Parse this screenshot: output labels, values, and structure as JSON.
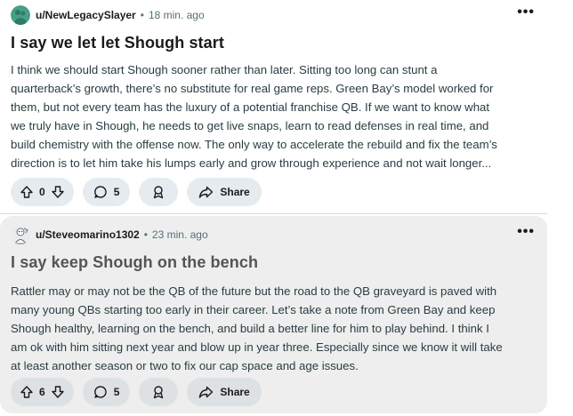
{
  "posts": [
    {
      "username": "u/NewLegacySlayer",
      "separator": "•",
      "time": "18 min. ago",
      "title": "I say we let let Shough start",
      "body_lines": [
        "I think we should start Shough sooner rather than later. Sitting too long can stunt a",
        "quarterback’s growth, there’s no substitute for real game reps. Green Bay’s model worked for",
        "them, but not every team has the luxury of a potential franchise QB. If we want to know what",
        "we truly have in Shough, he needs to get live snaps, learn to read defenses in real time, and",
        "build chemistry with the offense now. The only way to accelerate the rebuild and fix the team’s",
        "direction is to let him take his lumps early and grow through experience and not wait longer..."
      ],
      "votes": "0",
      "comments": "5",
      "share_label": "Share",
      "overflow": "•••"
    },
    {
      "username": "u/Steveomarino1302",
      "separator": "•",
      "time": "23 min. ago",
      "title": "I say keep Shough on the bench",
      "body_lines": [
        "Rattler may or may not be the QB of the future but the road to the QB graveyard is paved with",
        "many young QBs starting too early in their career. Let’s take a note from Green Bay and keep",
        "Shough healthy, learning on the bench, and build a better line for him to play behind. I think I",
        "am ok with him sitting next year and blow up in year three. Especially since we know it will take",
        "at least another season or two to fix our cap space and age issues."
      ],
      "votes": "6",
      "comments": "5",
      "share_label": "Share",
      "overflow": "•••"
    }
  ],
  "icons": {
    "upvote": "upvote-arrow-icon",
    "downvote": "downvote-arrow-icon",
    "comment": "comment-bubble-icon",
    "award": "award-icon",
    "share": "share-arrow-icon"
  },
  "colors": {
    "avatar_1": "#46a087",
    "avatar_2": "#cfd3d6",
    "pill_bg": "#e5ebee",
    "selected_post_bg": "#eeeeee"
  }
}
